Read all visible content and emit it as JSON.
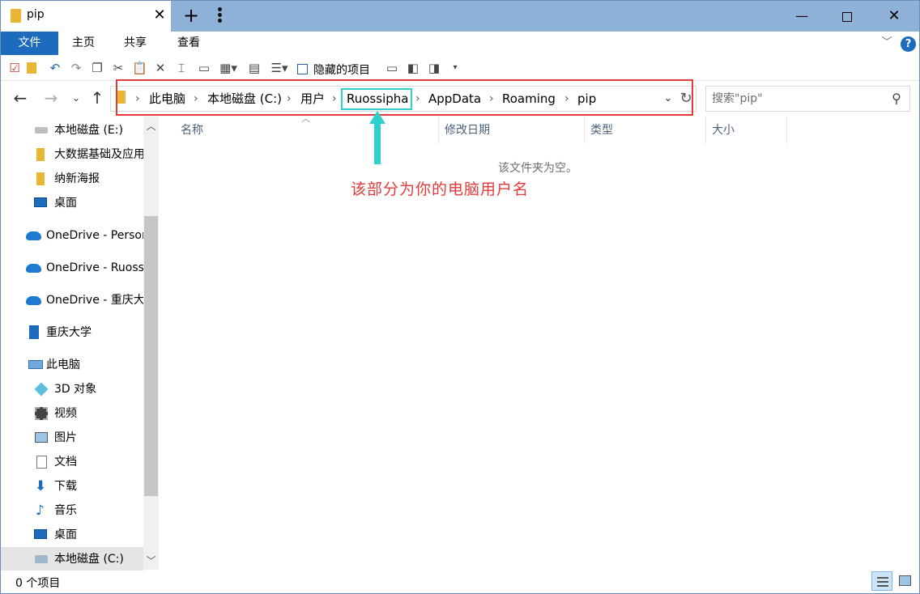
{
  "window": {
    "tab_title": "pip",
    "new_tab": "+",
    "close_tab": "✕",
    "minimize": "—",
    "close": "✕"
  },
  "ribbon": {
    "file": "文件",
    "home": "主页",
    "share": "共享",
    "view": "查看",
    "help": "?"
  },
  "quick_toolbar": {
    "hidden_items_label": "隐藏的项目"
  },
  "address": {
    "crumbs": [
      "此电脑",
      "本地磁盘 (C:)",
      "用户",
      "Ruossipha",
      "AppData",
      "Roaming",
      "pip"
    ],
    "search_placeholder": "搜索\"pip\""
  },
  "sidebar": {
    "items": [
      {
        "label": "本地磁盘 (E:)",
        "icon": "drive-icon"
      },
      {
        "label": "大数据基础及应用",
        "icon": "folder-icon"
      },
      {
        "label": "纳新海报",
        "icon": "folder-icon"
      },
      {
        "label": "桌面",
        "icon": "desktop-icon"
      },
      {
        "label": "OneDrive - Personal",
        "icon": "onedrive-icon"
      },
      {
        "label": "OneDrive - Ruossipha",
        "icon": "onedrive-icon"
      },
      {
        "label": "OneDrive - 重庆大学",
        "icon": "onedrive-icon"
      },
      {
        "label": "重庆大学",
        "icon": "building-icon"
      },
      {
        "label": "此电脑",
        "icon": "computer-icon"
      },
      {
        "label": "3D 对象",
        "icon": "cube-icon"
      },
      {
        "label": "视频",
        "icon": "video-icon"
      },
      {
        "label": "图片",
        "icon": "picture-icon"
      },
      {
        "label": "文档",
        "icon": "document-icon"
      },
      {
        "label": "下载",
        "icon": "download-icon"
      },
      {
        "label": "音乐",
        "icon": "music-icon"
      },
      {
        "label": "桌面",
        "icon": "desktop-icon"
      },
      {
        "label": "本地磁盘 (C:)",
        "icon": "windows-drive-icon"
      }
    ]
  },
  "columns": [
    "名称",
    "修改日期",
    "类型",
    "大小"
  ],
  "empty_message": "该文件夹为空。",
  "annotation": "该部分为你的电脑用户名",
  "status": {
    "item_count": "0 个项目"
  },
  "colors": {
    "titlebar": "#8eb1d8",
    "file_tab": "#1c6bbd",
    "highlight_red": "#e53a3a",
    "highlight_cyan": "#2fcfcf"
  }
}
